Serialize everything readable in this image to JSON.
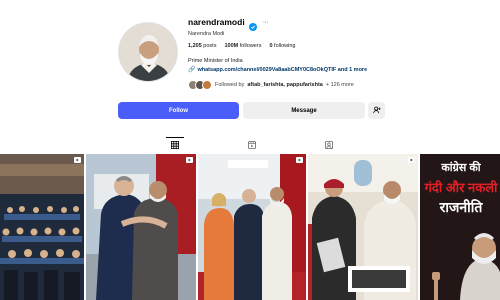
{
  "profile": {
    "username": "narendramodi",
    "fullname": "Narendra Modi",
    "stats": {
      "posts_count": "1,205",
      "posts_label": "posts",
      "followers_count": "100M",
      "followers_label": "followers",
      "following_count": "0",
      "following_label": "following"
    },
    "bio": "Prime Minister of India",
    "link": "whatsapp.com/channel/0029Va8aabCMY0C8oOkQTIF and 1 more",
    "followed_by": {
      "prefix": "Followed by",
      "names": "aftab_farishta, pappufarishta",
      "suffix": "+ 126 more"
    }
  },
  "actions": {
    "follow_label": "Follow",
    "message_label": "Message",
    "suggest_icon": "add-person-icon"
  },
  "tabs": [
    {
      "name": "posts",
      "icon": "grid-icon",
      "active": true
    },
    {
      "name": "reels",
      "icon": "reels-icon",
      "active": false
    },
    {
      "name": "tagged",
      "icon": "tagged-icon",
      "active": false
    }
  ],
  "posts": [
    {
      "description": "parliament-chamber",
      "type": "reel"
    },
    {
      "description": "embrace-on-red-carpet",
      "type": "reel"
    },
    {
      "description": "greeting-by-aircraft",
      "type": "reel"
    },
    {
      "description": "meeting-in-aircraft-cabin",
      "type": "reel"
    },
    {
      "description": "hindi-text-graphic",
      "type": "reel",
      "overlay_line1": "कांग्रेस की",
      "overlay_line2": "गंदी और नकली",
      "overlay_line3": "राजनीति"
    }
  ],
  "colors": {
    "follow_button": "#4a5df9",
    "secondary_button": "#efefef",
    "verified_badge": "#0095f6",
    "link": "#00376b"
  }
}
